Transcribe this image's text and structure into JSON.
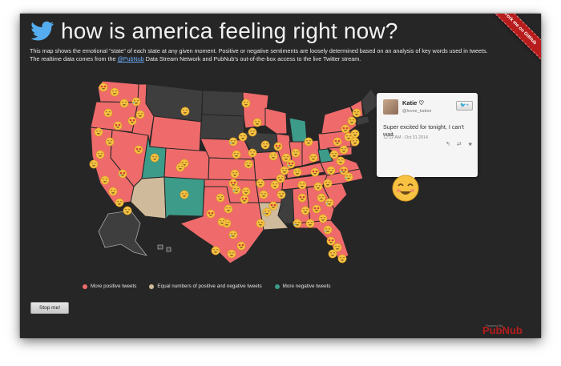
{
  "header": {
    "title": "how is america feeling right now?",
    "desc_before": "This map shows the emotional \"state\" of each state at any given moment. Positive or negative sentiments are loosely determined based on an analysis of key words used in tweets. The realtime data comes from the ",
    "desc_link": "@PubNub",
    "desc_after": " Data Stream Network and PubNub's out-of-the-box access to the live Twitter stream."
  },
  "ribbon": {
    "label": "Fork me on GitHub"
  },
  "tweet": {
    "name": "Katie ♡",
    "handle": "@lovee_katiee",
    "follow_label": "🐦+",
    "text": "Super excited for tonight, I can't wait.",
    "meta": "12:12 AM - Oct 31 2014",
    "actions": [
      "↰",
      "⇄",
      "★"
    ]
  },
  "legend": {
    "items": [
      {
        "label": "More positive tweets",
        "color": "#ef6b6b"
      },
      {
        "label": "Equal numbers of positive and negative tweets",
        "color": "#cfbb9b"
      },
      {
        "label": "More negative tweets",
        "color": "#3d9b89"
      }
    ]
  },
  "controls": {
    "stop_label": "Stop me!"
  },
  "footer": {
    "powered_by": "Powered By",
    "brand": "PubNub"
  },
  "colors": {
    "positive": "#ef6b6b",
    "neutral": "#cfbb9b",
    "negative": "#3d9b89",
    "no_data": "#3e3e3e",
    "background": "#262626"
  }
}
